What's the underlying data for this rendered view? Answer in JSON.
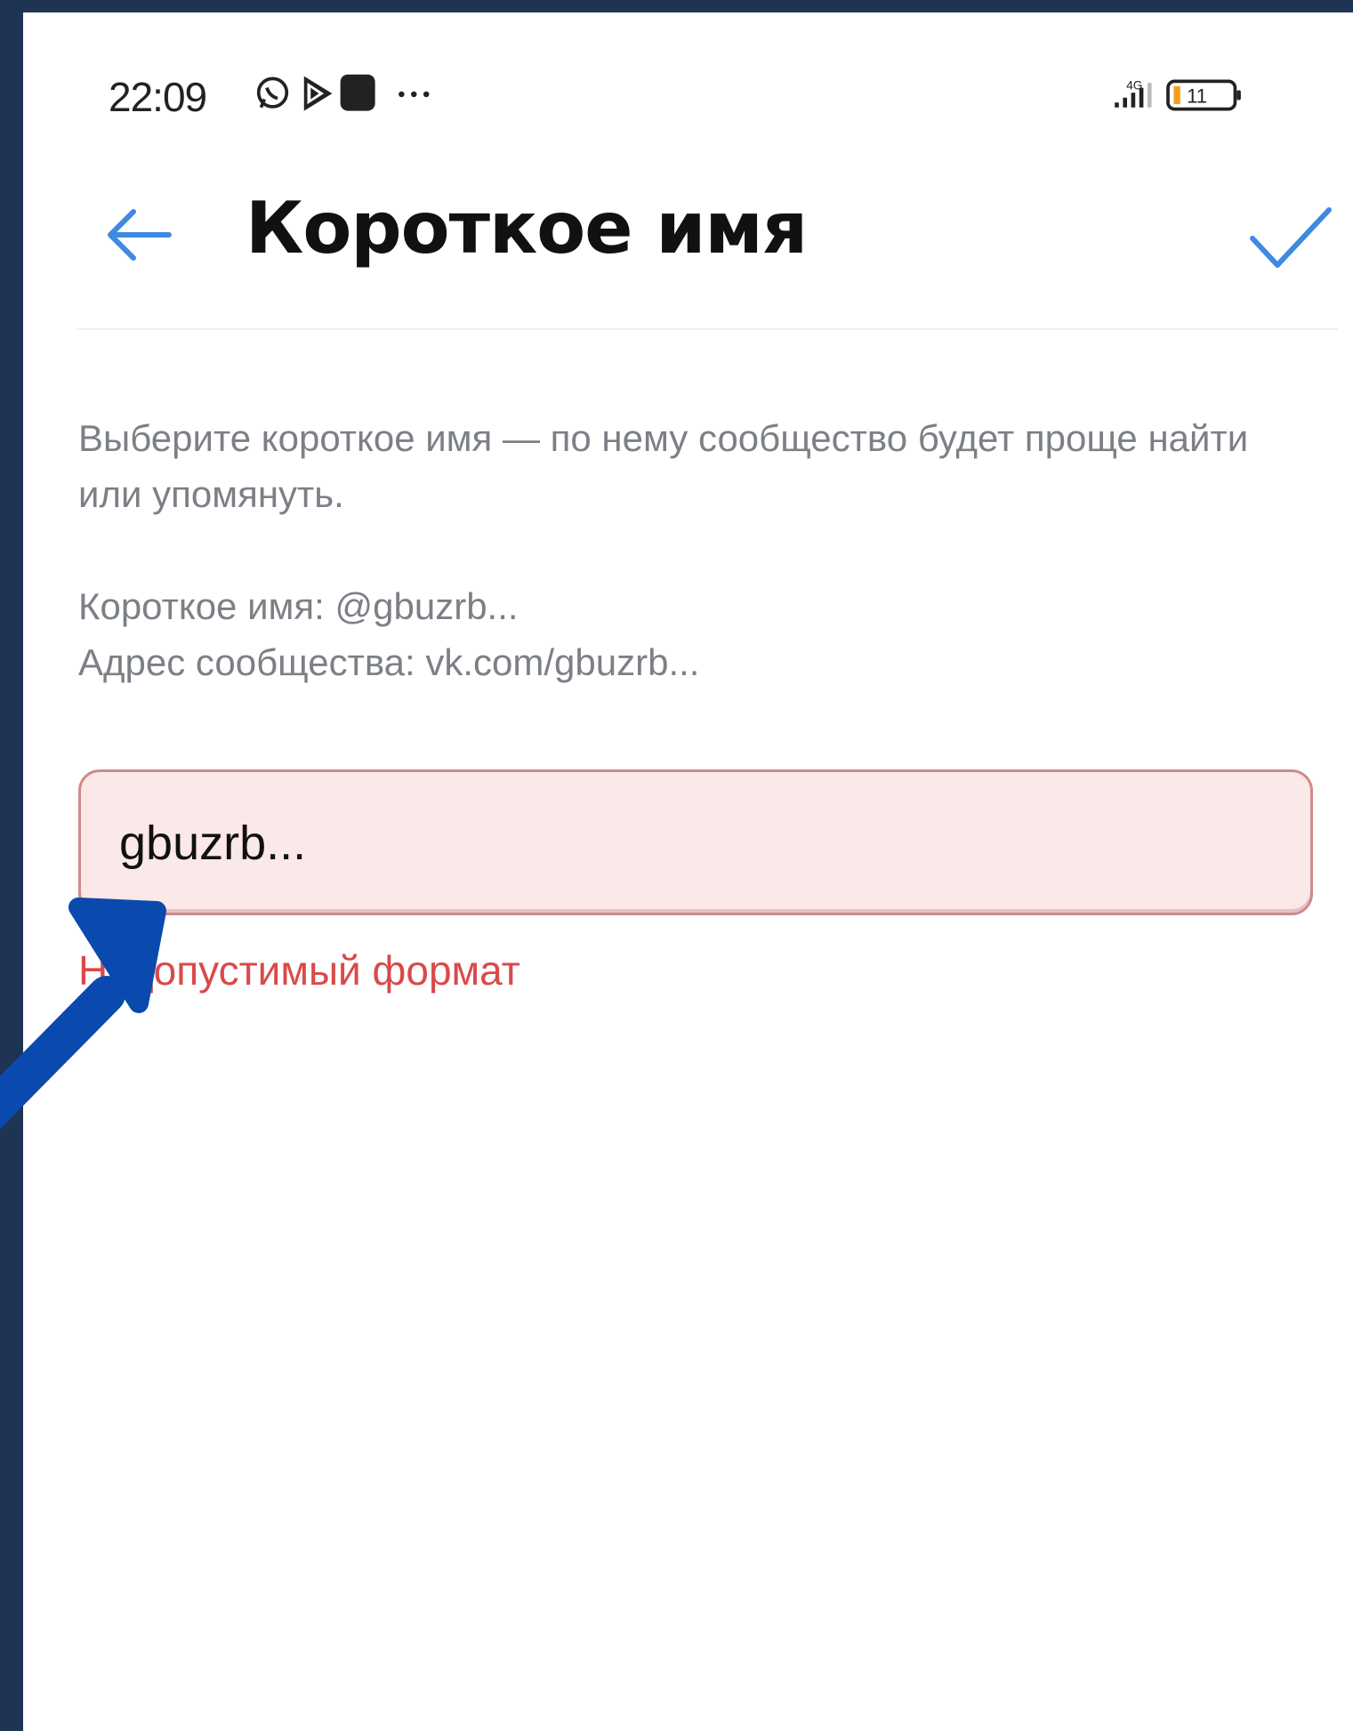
{
  "status_bar": {
    "time": "22:09",
    "network": "4G",
    "battery": "11"
  },
  "header": {
    "title": "Короткое имя",
    "back_icon": "arrow-left-icon",
    "confirm_icon": "checkmark-icon"
  },
  "description": "Выберите короткое имя — по нему сообщество будет проще найти или упомянуть.",
  "info": {
    "short_name_line": "Короткое имя: @gbuzrb...",
    "address_line": "Адрес сообщества: vk.com/gbuzrb..."
  },
  "input": {
    "value": "gbuzrb..."
  },
  "error": {
    "message": "Недопустимый формат"
  },
  "colors": {
    "accent": "#3f8ae0",
    "error": "#d94a4a",
    "frame": "#1f3453",
    "annotation_arrow": "#0a4aae"
  }
}
